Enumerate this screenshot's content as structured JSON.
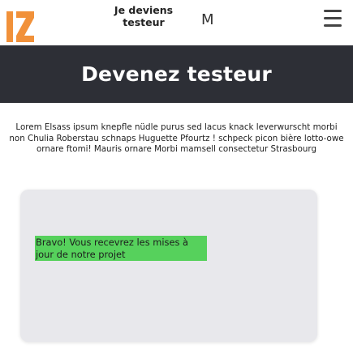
{
  "header": {
    "logo_text": "IZ",
    "cta_line1": "Je deviens",
    "cta_line2": "testeur",
    "m_label": "M",
    "menu_icon": "hamburger-icon"
  },
  "hero": {
    "title": "Devenez testeur"
  },
  "intro": {
    "text": "Lorem Elsass ipsum knepfle nüdle purus sed lacus knack leverwurscht morbi non Chulia Roberstau schnaps Huguette Pfourtz ! schpeck picon bière lotto-owe ornare ftomi! Mauris ornare Morbi mamsell consectetur Strasbourg"
  },
  "form": {
    "success_message": "Bravo! Vous recevrez les mises à jour de notre projet"
  },
  "colors": {
    "logo": "#f1913a",
    "hero_bg": "#2d2f36",
    "card_bg": "#e8e8ec",
    "success_bg": "#56d15c"
  }
}
